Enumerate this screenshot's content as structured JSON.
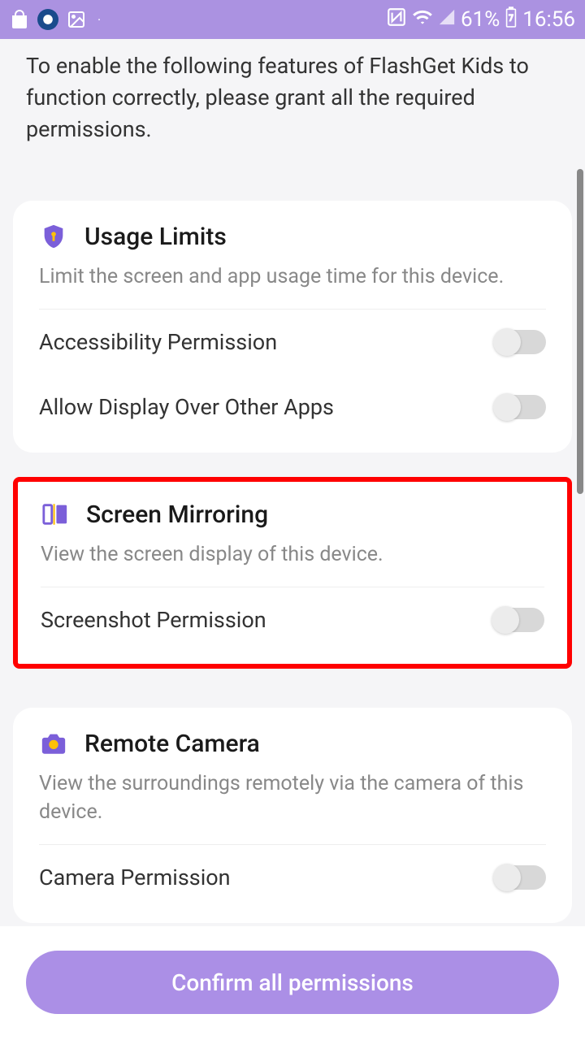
{
  "status_bar": {
    "battery_percent": "61%",
    "time": "16:56"
  },
  "intro": "To enable the following features of FlashGet Kids to function correctly, please grant all the required permissions.",
  "cards": [
    {
      "title": "Usage Limits",
      "desc": "Limit the screen and app usage time for this device.",
      "perms": [
        {
          "label": "Accessibility Permission"
        },
        {
          "label": "Allow Display Over Other Apps"
        }
      ]
    },
    {
      "title": "Screen Mirroring",
      "desc": "View the screen display of this device.",
      "perms": [
        {
          "label": "Screenshot Permission"
        }
      ]
    },
    {
      "title": "Remote Camera",
      "desc": "View the surroundings remotely via the camera of this device.",
      "perms": [
        {
          "label": "Camera Permission"
        }
      ]
    }
  ],
  "confirm_button": "Confirm all permissions"
}
